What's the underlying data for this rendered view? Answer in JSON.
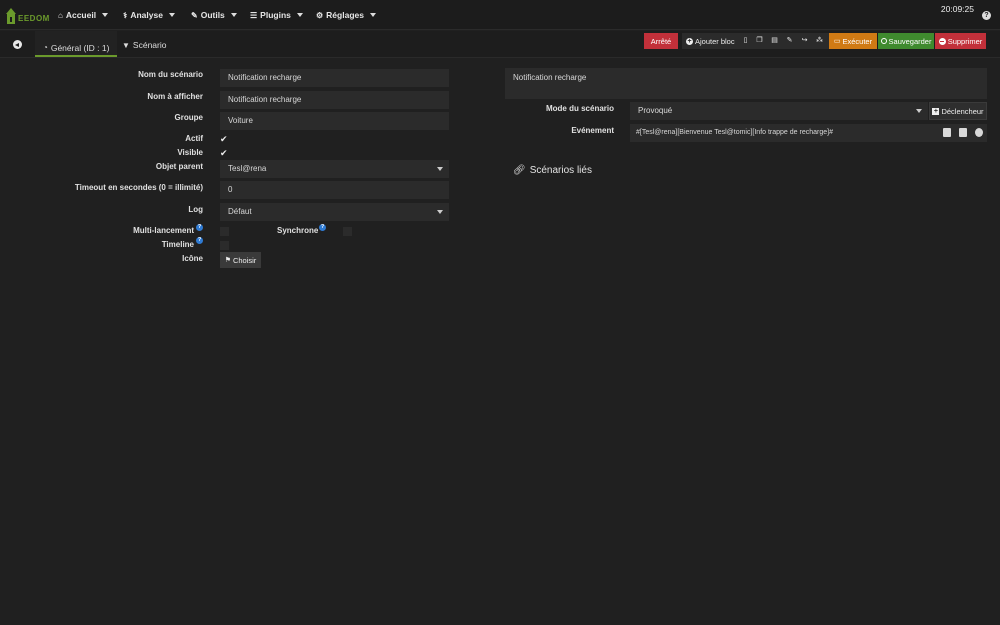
{
  "nav": {
    "logo_text": "EEDOM",
    "items": [
      {
        "label": "Accueil",
        "icon": "home-icon"
      },
      {
        "label": "Analyse",
        "icon": "stethoscope-icon"
      },
      {
        "label": "Outils",
        "icon": "wrench-icon"
      },
      {
        "label": "Plugins",
        "icon": "list-icon"
      },
      {
        "label": "Réglages",
        "icon": "gear-icon"
      }
    ],
    "clock": "20:09:25",
    "help": "?"
  },
  "tabs": {
    "general": "Général (ID : 1)",
    "scenario": "Scénario"
  },
  "toolbar": {
    "arrete": "Arrêté",
    "ajouter_bloc": "Ajouter bloc",
    "executer": "Exécuter",
    "sauvegarder": "Sauvegarder",
    "supprimer": "Supprimer"
  },
  "form": {
    "nom_label": "Nom du scénario",
    "nom_value": "Notification recharge",
    "afficher_label": "Nom à afficher",
    "afficher_value": "Notification recharge",
    "groupe_label": "Groupe",
    "groupe_value": "Voiture",
    "actif_label": "Actif",
    "actif_checked": true,
    "visible_label": "Visible",
    "visible_checked": true,
    "objet_label": "Objet parent",
    "objet_value": "Tesl@rena",
    "timeout_label": "Timeout en secondes (0 = illimité)",
    "timeout_value": "0",
    "log_label": "Log",
    "log_value": "Défaut",
    "multi_label": "Multi-lancement",
    "synchrone_label": "Synchrone",
    "timeline_label": "Timeline",
    "icone_label": "Icône",
    "choisir": "Choisir"
  },
  "right": {
    "description": "Notification recharge",
    "mode_label": "Mode du scénario",
    "mode_value": "Provoqué",
    "declencheur": "Déclencheur",
    "event_label": "Evénement",
    "event_value": "#[Tesl@rena][Bienvenue Tesl@tomic][Info trappe de recharge]#",
    "linked_title": "Scénarios liés"
  },
  "colors": {
    "background": "#202020",
    "field": "#2b2b2b",
    "danger": "#c2303a",
    "warning": "#d07a14",
    "success": "#3f8a2e",
    "brand": "#6b9a2c"
  }
}
